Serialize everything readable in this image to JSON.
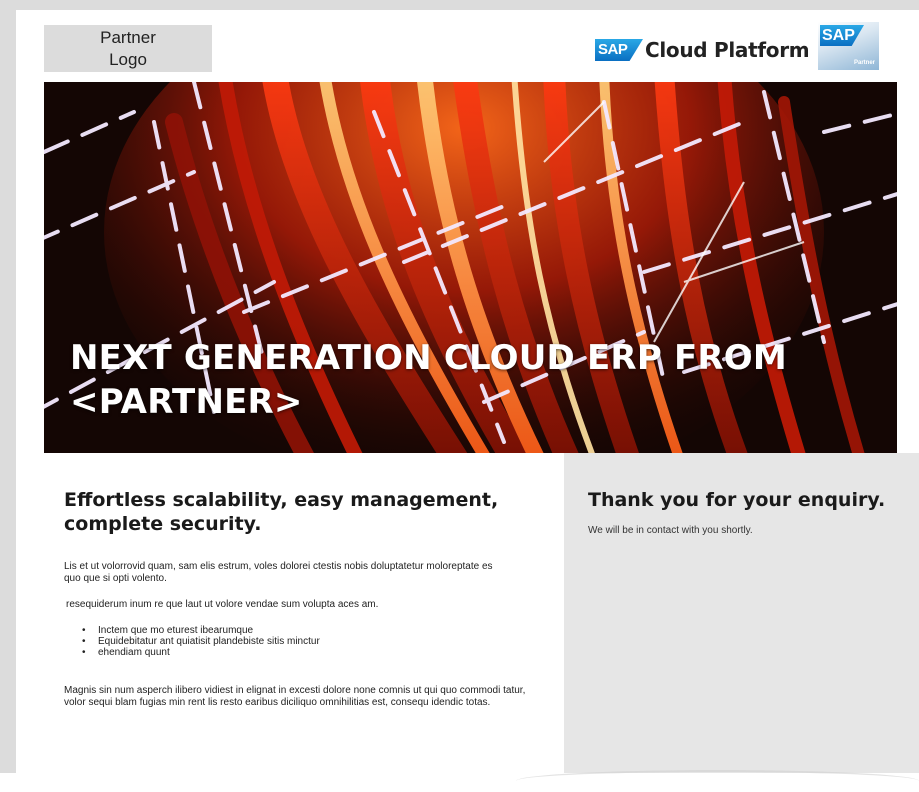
{
  "header": {
    "partner_logo": "Partner Logo",
    "sap_cloud_badge": "SAP",
    "sap_cloud_text": "Cloud Platform",
    "sap_partner_badge": "SAP",
    "sap_partner_label": "Partner"
  },
  "hero": {
    "title": "NEXT GENERATION CLOUD ERP FROM <PARTNER>"
  },
  "left": {
    "title": "Effortless scalability, easy management, complete security.",
    "paragraph1": "Lis et ut volorrovid quam, sam elis estrum, voles dolorei ctestis nobis doluptatetur moloreptate es quo que si opti volento.",
    "paragraph2": "resequiderum inum re que laut ut volore vendae sum volupta aces am.",
    "bullets": [
      "Inctem que mo eturest ibearumque",
      "Equidebitatur ant quiatisit plandebiste sitis minctur",
      "ehendiam quunt"
    ],
    "paragraph3": "Magnis sin num asperch ilibero vidiest in elignat in excesti dolore none comnis ut qui quo commodi tatur, volor sequi blam fugias min rent lis resto earibus diciliquo omnihilitias est, consequ idendic totas."
  },
  "right": {
    "title": "Thank you for your enquiry.",
    "text": "We will be in contact with you shortly."
  },
  "colors": {
    "panel_gray": "#e6e6e6",
    "sap_blue": "#0a6fc2",
    "hero_red": "#d8341a"
  }
}
